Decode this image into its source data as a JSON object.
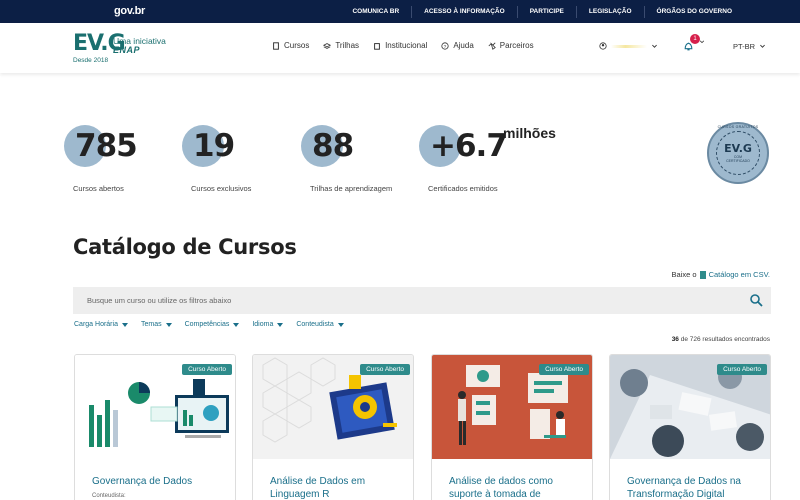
{
  "gov": {
    "logo": "gov.br",
    "links": [
      "COMUNICA BR",
      "ACESSO À INFORMAÇÃO",
      "PARTICIPE",
      "LEGISLAÇÃO",
      "ÓRGÃOS DO GOVERNO"
    ]
  },
  "header": {
    "brand": "EV.G",
    "tagline": "Uma iniciativa",
    "org": "ENAP",
    "since": "Desde 2018",
    "nav": [
      {
        "label": "Cursos",
        "icon": "book-icon"
      },
      {
        "label": "Trilhas",
        "icon": "layers-icon"
      },
      {
        "label": "Institucional",
        "icon": "building-icon"
      },
      {
        "label": "Ajuda",
        "icon": "help-icon"
      },
      {
        "label": "Parceiros",
        "icon": "handshake-icon"
      }
    ],
    "notifications": "1",
    "language": "PT-BR"
  },
  "stats": [
    {
      "value": "785",
      "label": "Cursos abertos"
    },
    {
      "value": "19",
      "label": "Cursos exclusivos"
    },
    {
      "value": "88",
      "label": "Trilhas de aprendizagem"
    },
    {
      "value": "+6.7",
      "suffix": "milhões",
      "label": "Certificados emitidos"
    }
  ],
  "seal": {
    "ring": "CURSOS GRATUITOS",
    "brand": "EV.G",
    "line1": "COM",
    "line2": "CERTIFICADO"
  },
  "catalog": {
    "title": "Catálogo de Cursos",
    "csv_prefix": "Baixe o",
    "csv_link": "Catálogo em CSV.",
    "search_placeholder": "Busque um curso ou utilize os filtros abaixo",
    "filters": [
      "Carga Horária",
      "Temas",
      "Competências",
      "Idioma",
      "Conteudista"
    ],
    "results_shown": "36",
    "results_text": "de 726 resultados encontrados"
  },
  "cards": [
    {
      "badge": "Curso Aberto",
      "title": "Governança de Dados",
      "sub": "Conteudista:"
    },
    {
      "badge": "Curso Aberto",
      "title": "Análise de Dados em Linguagem R",
      "sub": ""
    },
    {
      "badge": "Curso Aberto",
      "title": "Análise de dados como suporte à tomada de",
      "sub": ""
    },
    {
      "badge": "Curso Aberto",
      "title": "Governança de Dados na Transformação Digital",
      "sub": ""
    }
  ],
  "colors": {
    "navy": "#0c1f45",
    "teal": "#1a6f6f",
    "link": "#1a6f8a",
    "badge": "#2e8b8b",
    "stat_circle": "#9eb9ce"
  }
}
